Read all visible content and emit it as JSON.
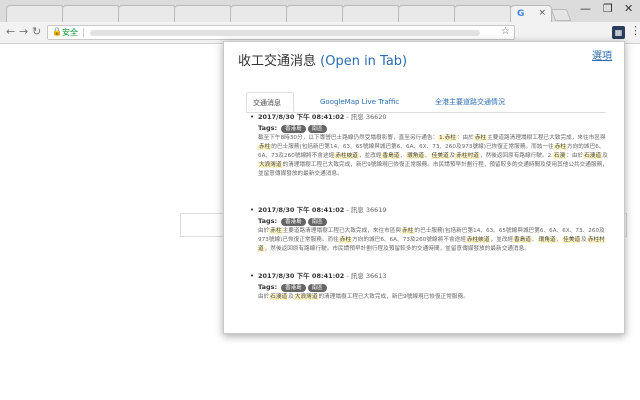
{
  "browser": {
    "tab_favicon": "G",
    "tab_close": "×",
    "window_controls": [
      "—",
      "❐",
      "✕"
    ],
    "secure_label": "安全",
    "menu_glyph": "⋮"
  },
  "popup": {
    "title": "收工交通消息 ",
    "title_link": "(Open in Tab)",
    "options": "選項",
    "tabs": [
      "交通消息",
      "GoogleMap Live Traffic",
      "全港主要道路交通情況"
    ]
  },
  "tags_label": "Tags:",
  "entries": [
    {
      "date": "2017/8/30 下午 08:41:02",
      "id": "- 訊息 36620",
      "tags": [
        "香港島",
        "南區"
      ],
      "body": [
        [
          "截至下午8時30分，以下專營巴士路線仍然受塌樹影響，直至另行通告：",
          ""
        ],
        [
          "1.",
          "赤柱"
        ],
        [
          "：由於",
          "赤柱"
        ],
        [
          "主要道路清理塌樹工程已大致完成，來往市區與",
          "赤柱"
        ],
        [
          "的巴士服務(包括新巴第14、63、65號線與城巴第6、6A、6X、73、260及973號線)已恢復正常服務。而originally",
          ""
        ]
      ]
    }
  ]
}
